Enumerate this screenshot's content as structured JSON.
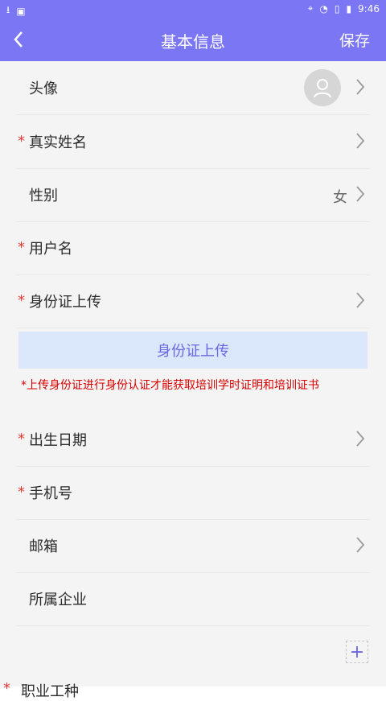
{
  "status_bar": {
    "time": "9:46",
    "icons_left": [
      "download-icon",
      "image-icon"
    ],
    "icons_right": [
      "location-icon",
      "wifi-icon",
      "no-sim-icon",
      "battery-icon"
    ]
  },
  "app_bar": {
    "title": "基本信息",
    "save_label": "保存",
    "background": "#7a76f4"
  },
  "fields": {
    "avatar_label": "头像",
    "real_name_label": "真实姓名",
    "gender_label": "性别",
    "gender_value": "女",
    "username_label": "用户名",
    "id_upload_label": "身份证上传",
    "birth_label": "出生日期",
    "phone_label": "手机号",
    "email_label": "邮箱",
    "company_label": "所属企业",
    "partial_label": "职业工种"
  },
  "required_mark": "*",
  "upload_button": "身份证上传",
  "notice": "*上传身份证进行身份认证才能获取培训学时证明和培训证书",
  "colors": {
    "accent": "#7a76f4",
    "required": "#e53935",
    "notice": "#d80000",
    "upload_bg": "#dbe8fc",
    "upload_text": "#6b66e2"
  }
}
